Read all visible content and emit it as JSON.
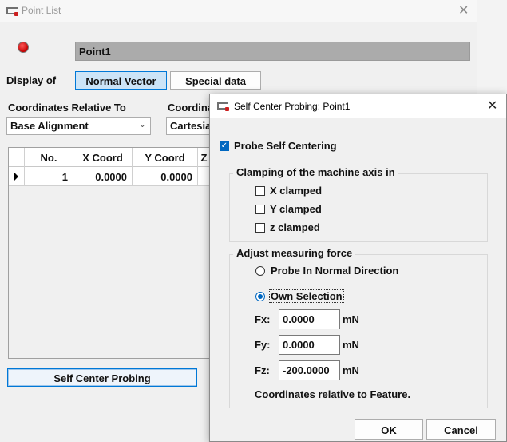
{
  "point_list": {
    "title": "Point List",
    "close_glyph": "✕",
    "point_name": "Point1",
    "display_of_label": "Display of",
    "normal_vector_label": "Normal Vector",
    "special_data_label": "Special data",
    "coordinates_relative_label": "Coordinates Relative To",
    "coordinate_system_label": "Coordina",
    "relative_to_value": "Base Alignment",
    "coordinate_system_value": "Cartesia",
    "table": {
      "headers": [
        "No.",
        "X Coord",
        "Y Coord",
        "Z"
      ],
      "rows": [
        [
          "1",
          "0.0000",
          "0.0000"
        ]
      ]
    },
    "self_center_button": "Self Center Probing"
  },
  "dialog": {
    "title": "Self Center Probing: Point1",
    "close_glyph": "✕",
    "probe_self_centering": "Probe Self Centering",
    "clamping_group_title": "Clamping of the machine axis in",
    "x_clamped": "X clamped",
    "y_clamped": "Y clamped",
    "z_clamped": "z clamped",
    "force_group_title": "Adjust measuring force",
    "probe_normal_direction": "Probe In Normal Direction",
    "own_selection": "Own Selection",
    "fx_label": "Fx:",
    "fx_value": "0.0000",
    "fy_label": "Fy:",
    "fy_value": "0.0000",
    "fz_label": "Fz:",
    "fz_value": "-200.0000",
    "unit": "mN",
    "coords_note": "Coordinates relative to Feature.",
    "ok_label": "OK",
    "cancel_label": "Cancel"
  },
  "colors": {
    "accent": "#0067c0",
    "selected_button_bg": "#cce4f7",
    "name_field_bg": "#ababab",
    "red_indicator": "#c40000"
  },
  "icons": [
    "app-icon",
    "close-icon",
    "chevron-down-icon",
    "row-pointer-icon",
    "check-icon"
  ]
}
